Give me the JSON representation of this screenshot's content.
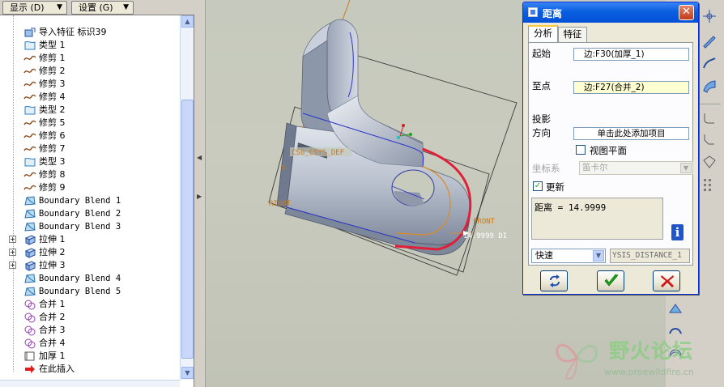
{
  "toolbar": {
    "show_label": "显示 (D)",
    "settings_label": "设置 (G)"
  },
  "model_tree": {
    "items": [
      {
        "label": "导入特征 标识39",
        "icon": "import-feature-icon",
        "expandable": false
      },
      {
        "label": "类型 1",
        "icon": "datum-curve-icon",
        "expandable": false
      },
      {
        "label": "修剪 1",
        "icon": "trim-curve-icon",
        "expandable": false
      },
      {
        "label": "修剪 2",
        "icon": "trim-curve-icon",
        "expandable": false
      },
      {
        "label": "修剪 3",
        "icon": "trim-curve-icon",
        "expandable": false
      },
      {
        "label": "修剪 4",
        "icon": "trim-curve-icon",
        "expandable": false
      },
      {
        "label": "类型 2",
        "icon": "datum-curve-icon",
        "expandable": false
      },
      {
        "label": "修剪 5",
        "icon": "trim-curve-icon",
        "expandable": false
      },
      {
        "label": "修剪 6",
        "icon": "trim-curve-icon",
        "expandable": false
      },
      {
        "label": "修剪 7",
        "icon": "trim-curve-icon",
        "expandable": false
      },
      {
        "label": "类型 3",
        "icon": "datum-curve-icon",
        "expandable": false
      },
      {
        "label": "修剪 8",
        "icon": "trim-curve-icon",
        "expandable": false
      },
      {
        "label": "修剪 9",
        "icon": "trim-curve-icon",
        "expandable": false
      },
      {
        "label": "Boundary Blend 1",
        "icon": "boundary-blend-icon",
        "expandable": false
      },
      {
        "label": "Boundary Blend 2",
        "icon": "boundary-blend-icon",
        "expandable": false
      },
      {
        "label": "Boundary Blend 3",
        "icon": "boundary-blend-icon",
        "expandable": false
      },
      {
        "label": "拉伸 1",
        "icon": "extrude-icon",
        "expandable": true
      },
      {
        "label": "拉伸 2",
        "icon": "extrude-icon",
        "expandable": true
      },
      {
        "label": "拉伸 3",
        "icon": "extrude-icon",
        "expandable": true
      },
      {
        "label": "Boundary Blend 4",
        "icon": "boundary-blend-icon",
        "expandable": false
      },
      {
        "label": "Boundary Blend 5",
        "icon": "boundary-blend-icon",
        "expandable": false
      },
      {
        "label": "合并 1",
        "icon": "merge-icon",
        "expandable": false
      },
      {
        "label": "合并 2",
        "icon": "merge-icon",
        "expandable": false
      },
      {
        "label": "合并 3",
        "icon": "merge-icon",
        "expandable": false
      },
      {
        "label": "合并 4",
        "icon": "merge-icon",
        "expandable": false
      },
      {
        "label": "加厚 1",
        "icon": "thicken-icon",
        "expandable": false
      },
      {
        "label": "在此插入",
        "icon": "insert-here-arrow-icon",
        "expandable": false
      }
    ]
  },
  "graphics": {
    "csys_label": "CS0_CSYS_DEF",
    "right_plane_label": "RIGHT",
    "front_plane_label": "FRONT",
    "distance_annotation": "14.9999  DI",
    "background_color": "#c6c9bd",
    "highlight_color": "#e0203a",
    "datum_color": "#c97a1a"
  },
  "dialog": {
    "title": "距离",
    "tabs": [
      "分析",
      "特征"
    ],
    "from_label": "起始",
    "from_value": "边:F30(加厚_1)",
    "to_label": "至点",
    "to_value": "边:F27(合并_2)",
    "projection_label": "投影",
    "direction_label": "方向",
    "direction_value": "单击此处添加项目",
    "view_plane_label": "视图平面",
    "view_plane_checked": false,
    "csys_label": "坐标系",
    "csys_value": "笛卡尔",
    "update_label": "更新",
    "update_checked": true,
    "result": "距离 = 14.9999",
    "mode_value": "快速",
    "analysis_name": "YSIS_DISTANCE_1",
    "buttons": [
      "repeat-icon",
      "ok-check-icon",
      "cancel-x-icon"
    ]
  },
  "watermark": {
    "title": "野火论坛",
    "url": "www.proewildfire.cn"
  }
}
